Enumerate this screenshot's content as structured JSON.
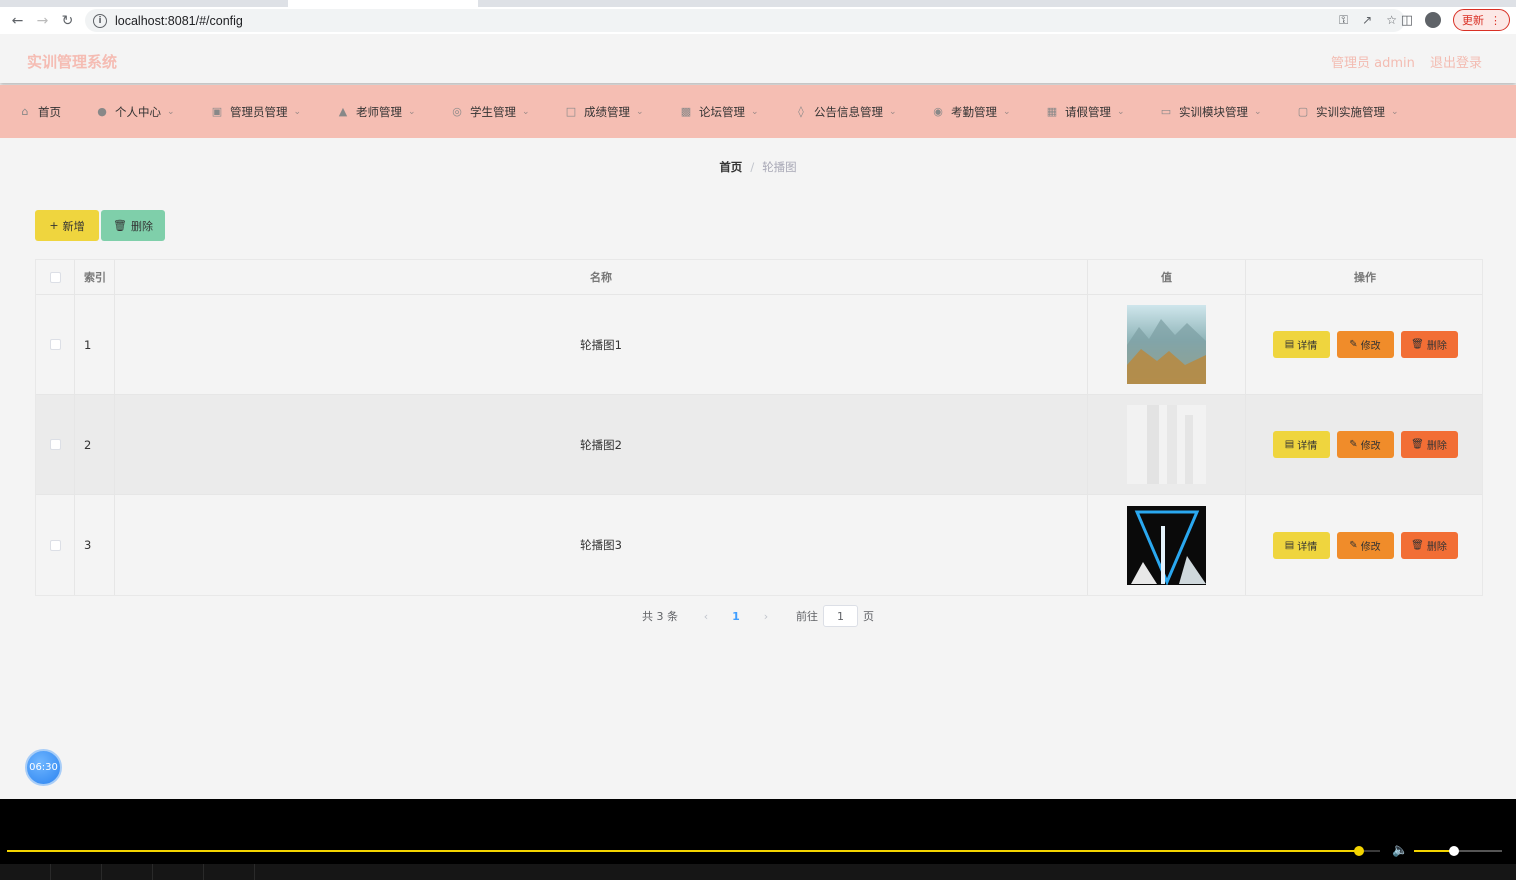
{
  "browser": {
    "url": "localhost:8081/#/config",
    "update_label": "更新"
  },
  "header": {
    "brand": "实训管理系统",
    "user": "管理员 admin",
    "logout": "退出登录"
  },
  "menu": [
    {
      "label": "首页",
      "icon": "home-icon"
    },
    {
      "label": "个人中心",
      "icon": "user-icon"
    },
    {
      "label": "管理员管理",
      "icon": "admin-icon"
    },
    {
      "label": "老师管理",
      "icon": "teacher-icon"
    },
    {
      "label": "学生管理",
      "icon": "student-icon"
    },
    {
      "label": "成绩管理",
      "icon": "grade-icon"
    },
    {
      "label": "论坛管理",
      "icon": "forum-icon"
    },
    {
      "label": "公告信息管理",
      "icon": "notice-icon"
    },
    {
      "label": "考勤管理",
      "icon": "attendance-icon"
    },
    {
      "label": "请假管理",
      "icon": "leave-icon"
    },
    {
      "label": "实训模块管理",
      "icon": "module-icon"
    },
    {
      "label": "实训实施管理",
      "icon": "implement-icon"
    }
  ],
  "breadcrumb": {
    "home": "首页",
    "current": "轮播图"
  },
  "toolbar": {
    "add_label": "新增",
    "delete_label": "删除"
  },
  "table": {
    "headers": {
      "index": "索引",
      "name": "名称",
      "value": "值",
      "actions": "操作"
    },
    "rows": [
      {
        "index": "1",
        "name": "轮播图1"
      },
      {
        "index": "2",
        "name": "轮播图2"
      },
      {
        "index": "3",
        "name": "轮播图3"
      }
    ],
    "actions": {
      "detail": "详情",
      "edit": "修改",
      "delete": "删除"
    }
  },
  "pagination": {
    "total": "共 3 条",
    "current_page": "1",
    "goto_label": "前往",
    "goto_value": "1",
    "page_suffix": "页"
  },
  "timer": "06:30",
  "player": {
    "progress_fraction": 0.985,
    "volume_fraction": 0.45
  },
  "colors": {
    "menubar": "#f5beb3",
    "brand_text": "#f5bcb3",
    "add_button": "#efd53e",
    "delete_button": "#7fcfaa",
    "edit_button": "#f08c2a",
    "row_delete_button": "#f26e35",
    "player_accent": "#f3d400"
  }
}
